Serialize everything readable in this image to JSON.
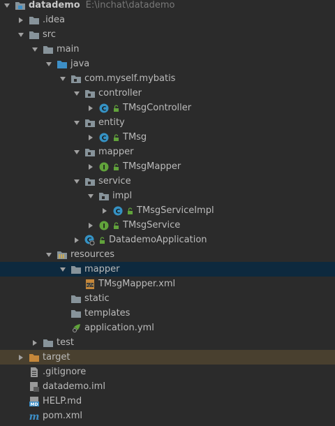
{
  "colors": {
    "background": "#2b2b2b",
    "selected_row": "#0d293e",
    "excluded_row": "#49402f",
    "folder": "#87939a",
    "source_folder": "#3d8fc7",
    "class_icon": "#3592c4",
    "interface_icon": "#61a33b",
    "excluded_folder": "#c5873a"
  },
  "tree": {
    "root": {
      "label": "datademo",
      "path": "E:\\inchat\\datademo"
    },
    "idea": {
      "label": ".idea"
    },
    "src": {
      "label": "src"
    },
    "main": {
      "label": "main"
    },
    "java": {
      "label": "java"
    },
    "package": {
      "label": "com.myself.mybatis"
    },
    "controller": {
      "label": "controller"
    },
    "tmsg_controller": {
      "label": "TMsgController"
    },
    "entity": {
      "label": "entity"
    },
    "tmsg": {
      "label": "TMsg"
    },
    "mapper_pkg": {
      "label": "mapper"
    },
    "tmsg_mapper": {
      "label": "TMsgMapper"
    },
    "service": {
      "label": "service"
    },
    "impl": {
      "label": "impl"
    },
    "tmsg_service_impl": {
      "label": "TMsgServiceImpl"
    },
    "tmsg_service": {
      "label": "TMsgService"
    },
    "datademo_application": {
      "label": "DatademoApplication"
    },
    "resources": {
      "label": "resources"
    },
    "mapper_res": {
      "label": "mapper"
    },
    "tmsg_mapper_xml": {
      "label": "TMsgMapper.xml"
    },
    "static": {
      "label": "static"
    },
    "templates": {
      "label": "templates"
    },
    "application_yml": {
      "label": "application.yml"
    },
    "test": {
      "label": "test"
    },
    "target": {
      "label": "target"
    },
    "gitignore": {
      "label": ".gitignore"
    },
    "datademo_iml": {
      "label": "datademo.iml"
    },
    "help_md": {
      "label": "HELP.md"
    },
    "pom_xml": {
      "label": "pom.xml"
    }
  }
}
